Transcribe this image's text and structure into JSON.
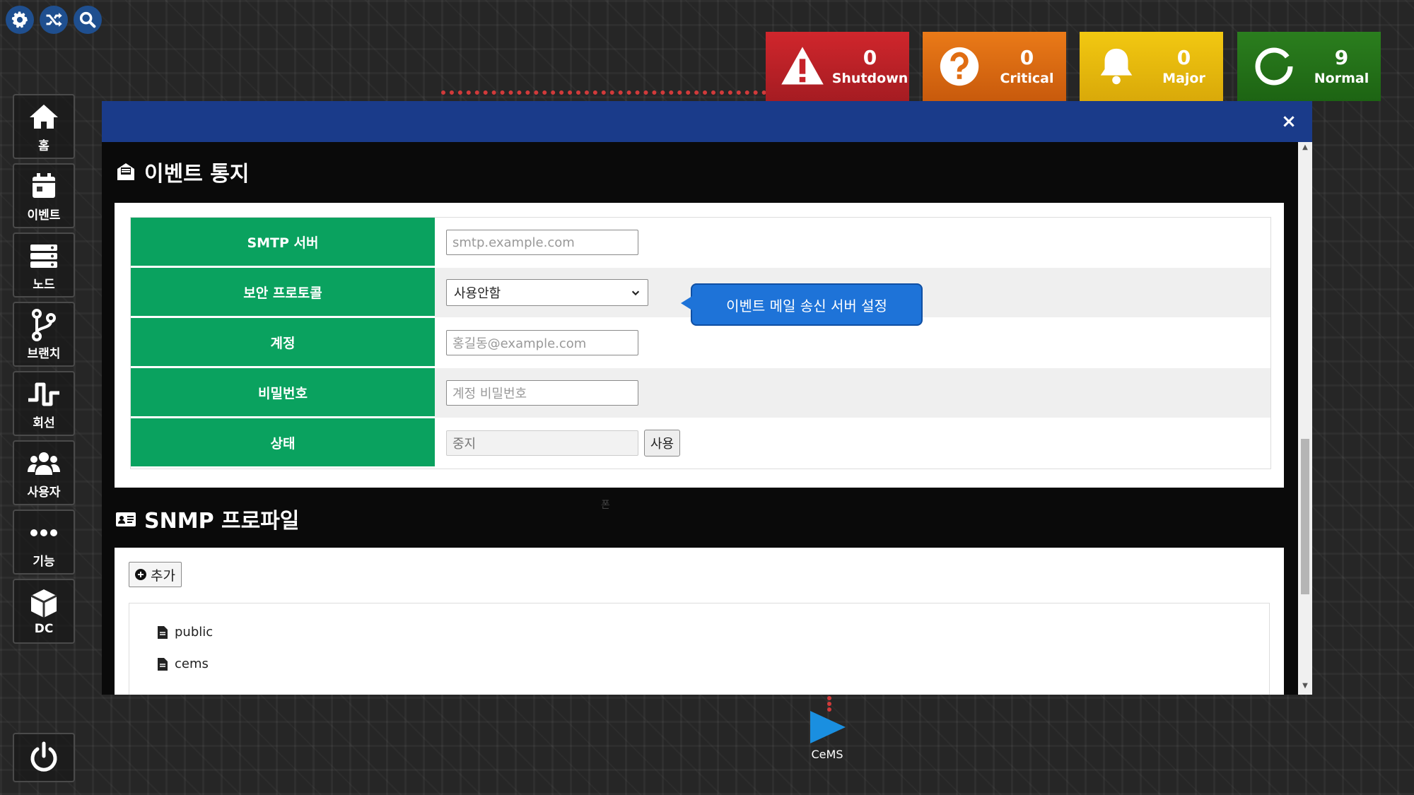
{
  "toolbar": {
    "icons": [
      "gear-icon",
      "shuffle-icon",
      "search-icon"
    ]
  },
  "status_tiles": [
    {
      "key": "shutdown",
      "count": "0",
      "label": "Shutdown",
      "color": "#c62229",
      "icon": "warning-icon"
    },
    {
      "key": "critical",
      "count": "0",
      "label": "Critical",
      "color": "#e06d12",
      "icon": "question-icon"
    },
    {
      "key": "major",
      "count": "0",
      "label": "Major",
      "color": "#eebd0e",
      "icon": "bell-icon"
    },
    {
      "key": "normal",
      "count": "9",
      "label": "Normal",
      "color": "#257019",
      "icon": "ring-icon"
    }
  ],
  "sidebar": {
    "items": [
      {
        "label": "홈",
        "icon": "home-icon"
      },
      {
        "label": "이벤트",
        "icon": "calendar-icon"
      },
      {
        "label": "노드",
        "icon": "server-icon"
      },
      {
        "label": "브랜치",
        "icon": "branch-icon"
      },
      {
        "label": "회선",
        "icon": "signal-icon"
      },
      {
        "label": "사용자",
        "icon": "users-icon"
      },
      {
        "label": "기능",
        "icon": "more-icon"
      },
      {
        "label": "DC",
        "icon": "cube-icon"
      }
    ],
    "power_icon": "power-icon"
  },
  "modal": {
    "close_label": "×",
    "event_section": {
      "title": "이벤트 통지",
      "rows": {
        "smtp_label": "SMTP 서버",
        "smtp_placeholder": "smtp.example.com",
        "protocol_label": "보안 프로토콜",
        "protocol_value": "사용안함",
        "account_label": "계정",
        "account_placeholder": "홍길동@example.com",
        "password_label": "비밀번호",
        "password_placeholder": "계정 비밀번호",
        "status_label": "상태",
        "status_value": "중지",
        "status_button": "사용"
      },
      "tooltip": "이벤트 메일 송신 서버 설정"
    },
    "snmp_section": {
      "title": "SNMP 프로파일",
      "add_button": "추가",
      "profiles": [
        "public",
        "cems"
      ]
    },
    "stray_text": "폰"
  },
  "footer": {
    "play_label": "CeMS"
  },
  "colors": {
    "modal_header": "#1a3b8a",
    "form_label_bg": "#0aa25f",
    "tooltip_bg": "#1e73d8"
  }
}
